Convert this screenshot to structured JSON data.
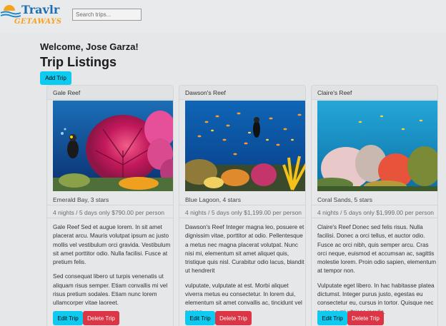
{
  "logo": {
    "name": "Travlr",
    "tagline": "GETAWAYS"
  },
  "search": {
    "placeholder": "Search trips..."
  },
  "welcome": "Welcome, Jose Garza!",
  "page_title": "Trip Listings",
  "add_button": "Add Trip",
  "trips": [
    {
      "name": "Gale Reef",
      "location": "Emerald Bay, 3 stars",
      "price": "4 nights / 5 days only $790.00 per person",
      "desc1": "Gale Reef Sed et augue lorem. In sit amet placerat arcu. Mauris volutpat ipsum ac justo mollis vel vestibulum orci gravida. Vestibulum sit amet porttitor odio. Nulla facilisi. Fusce at pretium felis.",
      "desc2": "Sed consequat libero ut turpis venenatis ut aliquam risus semper. Etiam convallis mi vel risus pretium sodales. Etiam nunc lorem ullamcorper vitae laoreet.",
      "edit": "Edit Trip",
      "delete": "Delete Trip"
    },
    {
      "name": "Dawson's Reef",
      "location": "Blue Lagoon, 4 stars",
      "price": "4 nights / 5 days only $1,199.00 per person",
      "desc1": "Dawson's Reef Integer magna leo, posuere et dignissim vitae, porttitor at odio. Pellentesque a metus nec magna placerat volutpat. Nunc nisi mi, elementum sit amet aliquet quis, tristique quis nisl. Curabitur odio lacus, blandit ut hendrerit",
      "desc2": "vulputate, vulputate at est. Morbi aliquet viverra metus eu consectetur. In lorem dui, elementum sit amet convallis ac, tincidunt vel sapien.",
      "edit": "Edit Trip",
      "delete": "Delete Trip"
    },
    {
      "name": "Claire's Reef",
      "location": "Coral Sands, 5 stars",
      "price": "4 nights / 5 days only $1,999.00 per person",
      "desc1": "Claire's Reef Donec sed felis risus. Nulla facilisi. Donec a orci tellus, et auctor odio. Fusce ac orci nibh, quis semper arcu. Cras orci neque, euismod et accumsan ac, sagittis molestie lorem. Proin odio sapien, elementum at tempor non.",
      "desc2": "Vulputate eget libero. In hac habitasse platea dictumst. Integer purus justo, egestas eu consectetur eu, cursus in tortor. Quisque nec nunc ac mi ultrices iaculis.",
      "edit": "Edit Trip",
      "delete": "Delete Trip"
    }
  ],
  "colors": {
    "accent": "#0dcaf0",
    "danger": "#dc3545",
    "background": "#e6e7e9"
  }
}
